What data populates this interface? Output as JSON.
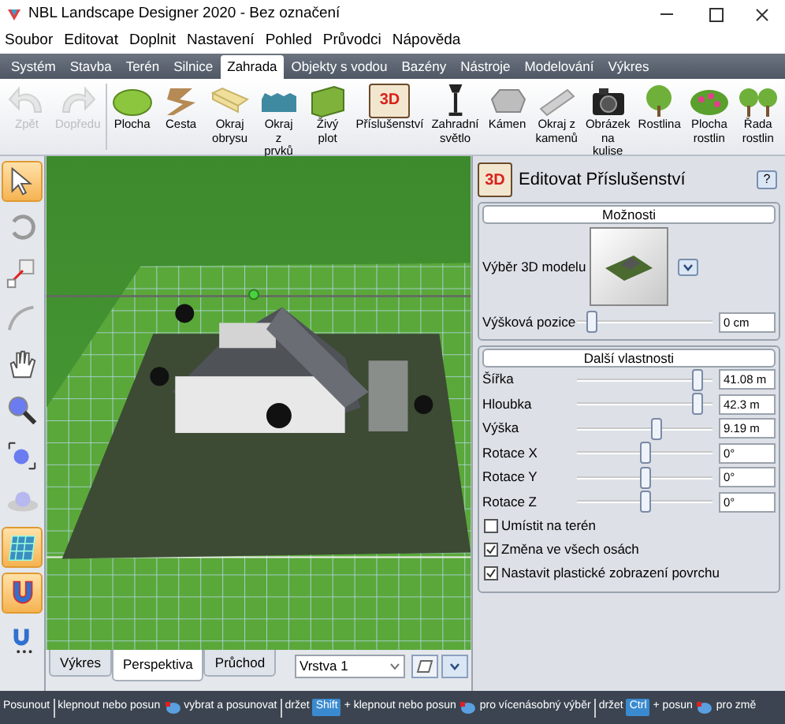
{
  "window": {
    "title": "NBL Landscape Designer 2020 - Bez označení"
  },
  "menu": [
    "Soubor",
    "Editovat",
    "Doplnit",
    "Nastavení",
    "Pohled",
    "Průvodci",
    "Nápověda"
  ],
  "ribbon_tabs": [
    {
      "label": "Systém",
      "selected": false
    },
    {
      "label": "Stavba",
      "selected": false
    },
    {
      "label": "Terén",
      "selected": false
    },
    {
      "label": "Silnice",
      "selected": false
    },
    {
      "label": "Zahrada",
      "selected": true
    },
    {
      "label": "Objekty s vodou",
      "selected": false
    },
    {
      "label": "Bazény",
      "selected": false
    },
    {
      "label": "Nástroje",
      "selected": false
    },
    {
      "label": "Modelování",
      "selected": false
    },
    {
      "label": "Výkres",
      "selected": false
    }
  ],
  "toolbar": [
    {
      "label": "Zpět",
      "disabled": true
    },
    {
      "label": "Dopředu",
      "disabled": true
    },
    {
      "label": "Plocha",
      "disabled": false
    },
    {
      "label": "Cesta",
      "disabled": false
    },
    {
      "label": "Okraj obrysu",
      "disabled": false
    },
    {
      "label": "Okraj z prvků",
      "disabled": false
    },
    {
      "label": "Živý plot",
      "disabled": false
    },
    {
      "label": "Příslušenství",
      "disabled": false,
      "icon_text": "3D"
    },
    {
      "label": "Zahradní světlo",
      "disabled": false
    },
    {
      "label": "Kámen",
      "disabled": false
    },
    {
      "label": "Okraj z kamenů",
      "disabled": false
    },
    {
      "label": "Obrázek na kulise",
      "disabled": false
    },
    {
      "label": "Rostlina",
      "disabled": false
    },
    {
      "label": "Plocha rostlin",
      "disabled": false
    },
    {
      "label": "Řada rostlin",
      "disabled": false
    }
  ],
  "tools": [
    {
      "selected": true
    },
    {
      "selected": false
    },
    {
      "selected": false
    },
    {
      "selected": false
    },
    {
      "selected": false
    },
    {
      "selected": false
    },
    {
      "selected": false
    },
    {
      "selected": false
    },
    {
      "selected": true
    },
    {
      "selected": true
    },
    {
      "selected": false
    }
  ],
  "view_tabs": [
    {
      "label": "Výkres",
      "selected": false
    },
    {
      "label": "Perspektiva",
      "selected": true
    },
    {
      "label": "Průchod",
      "selected": false
    }
  ],
  "layer_select": {
    "value": "Vrstva 1"
  },
  "panel": {
    "icon_text": "3D",
    "title": "Editovat Příslušenství",
    "help": "?",
    "section_1": "Možnosti",
    "model_label": "Výběr 3D modelu",
    "height_row": {
      "label": "Výšková pozice",
      "level": 0.1,
      "value": "0 cm"
    },
    "section_2": "Další vlastnosti",
    "rows": [
      {
        "label": "Šířka",
        "level": 0.88,
        "value": "41.08 m"
      },
      {
        "label": "Hloubka",
        "level": 0.88,
        "value": "42.3 m"
      },
      {
        "label": "Výška",
        "level": 0.58,
        "value": "9.19 m"
      },
      {
        "label": "Rotace X",
        "level": 0.5,
        "value": "0°"
      },
      {
        "label": "Rotace Y",
        "level": 0.5,
        "value": "0°"
      },
      {
        "label": "Rotace Z",
        "level": 0.5,
        "value": "0°"
      }
    ],
    "checkboxes": [
      {
        "label": "Umístit na terén",
        "checked": false
      },
      {
        "label": "Změna ve všech osách",
        "checked": true
      },
      {
        "label": "Nastavit plastické zobrazení povrchu",
        "checked": true
      }
    ]
  },
  "status_bar": [
    {
      "kind": "text",
      "text": "Posunout"
    },
    {
      "kind": "sep"
    },
    {
      "kind": "text",
      "text": "klepnout nebo posun"
    },
    {
      "kind": "mouse"
    },
    {
      "kind": "text",
      "text": "vybrat a posunovat"
    },
    {
      "kind": "sep"
    },
    {
      "kind": "text",
      "text": "držet"
    },
    {
      "kind": "key",
      "text": "Shift"
    },
    {
      "kind": "text",
      "text": "+ klepnout nebo posun"
    },
    {
      "kind": "mouse"
    },
    {
      "kind": "text",
      "text": "pro vícenásobný výběr"
    },
    {
      "kind": "sep"
    },
    {
      "kind": "text",
      "text": "držet"
    },
    {
      "kind": "key",
      "text": "Ctrl"
    },
    {
      "kind": "text",
      "text": "+ posun"
    },
    {
      "kind": "mouse"
    },
    {
      "kind": "text",
      "text": "pro změ"
    }
  ]
}
